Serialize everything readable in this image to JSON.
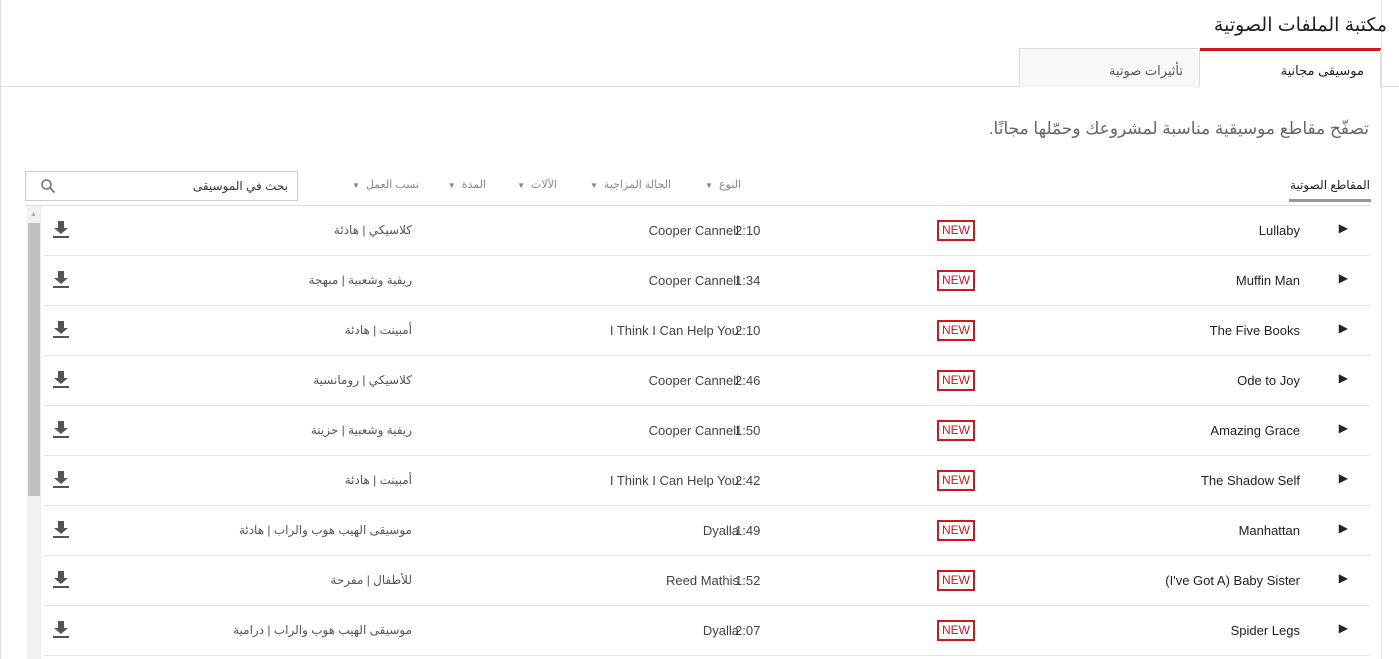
{
  "header": {
    "title": "مكتبة الملفات الصوتية"
  },
  "tabs": [
    {
      "label": "موسيقى مجانية",
      "active": true
    },
    {
      "label": "تأثيرات صوتية",
      "active": false
    }
  ],
  "description": "تصفّح مقاطع موسيقية مناسبة لمشروعك وحمّلها مجانًا.",
  "subtab": "المقاطع الصوتية",
  "filters": [
    "النوع",
    "الحالة المزاجية",
    "الآلات",
    "المدة",
    "نسب العمل"
  ],
  "search": {
    "placeholder": "بحث في الموسيقى",
    "value": ""
  },
  "badge": "NEW",
  "colors": {
    "accent": "#cc181e"
  },
  "tracks": [
    {
      "title": "Lullaby",
      "duration": "2:10",
      "artist": "Cooper Cannell",
      "genre": "كلاسيكي | هادئة"
    },
    {
      "title": "Muffin Man",
      "duration": "1:34",
      "artist": "Cooper Cannell",
      "genre": "ريفية وشعبية | مبهجة"
    },
    {
      "title": "The Five Books",
      "duration": "2:10",
      "artist": "I Think I Can Help You",
      "genre": "أمبينت | هادئة"
    },
    {
      "title": "Ode to Joy",
      "duration": "2:46",
      "artist": "Cooper Cannell",
      "genre": "كلاسيكي | رومانسية"
    },
    {
      "title": "Amazing Grace",
      "duration": "1:50",
      "artist": "Cooper Cannell",
      "genre": "ريفية وشعبية | حزينة"
    },
    {
      "title": "The Shadow Self",
      "duration": "2:42",
      "artist": "I Think I Can Help You",
      "genre": "أمبينت | هادئة"
    },
    {
      "title": "Manhattan",
      "duration": "1:49",
      "artist": "Dyalla",
      "genre": "موسيقى الهيب هوب والراب | هادئة"
    },
    {
      "title": "(I've Got A) Baby Sister",
      "duration": "1:52",
      "artist": "Reed Mathis",
      "genre": "للأطفال | مفرحة"
    },
    {
      "title": "Spider Legs",
      "duration": "2:07",
      "artist": "Dyalla",
      "genre": "موسيقى الهيب هوب والراب | درامية"
    }
  ]
}
